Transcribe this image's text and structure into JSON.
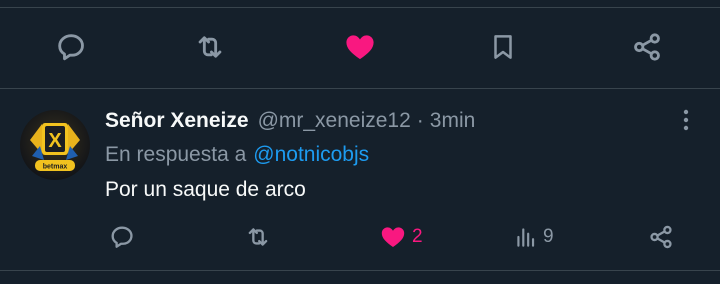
{
  "colors": {
    "background": "#15202b",
    "divider": "#38444d",
    "icon_gray": "#8b98a5",
    "like_pink": "#f91880",
    "link_blue": "#1d9bf0",
    "text_primary": "#f7f9f9",
    "text_secondary": "#8b98a5"
  },
  "top_action_bar": {
    "icons": [
      "reply-icon",
      "retweet-icon",
      "like-icon-filled",
      "bookmark-icon",
      "share-icon"
    ],
    "liked": true
  },
  "reply_tweet": {
    "display_name": "Señor Xeneize",
    "handle": "@mr_xeneize12",
    "separator": "·",
    "time": "3min",
    "reply_prefix": "En respuesta a",
    "reply_mention": "@notnicobjs",
    "text": "Por un saque de arco",
    "avatar_logo_letter": "X",
    "avatar_badge_text": "betmax",
    "actions": {
      "likes": "2",
      "views": "9",
      "liked": true
    }
  }
}
